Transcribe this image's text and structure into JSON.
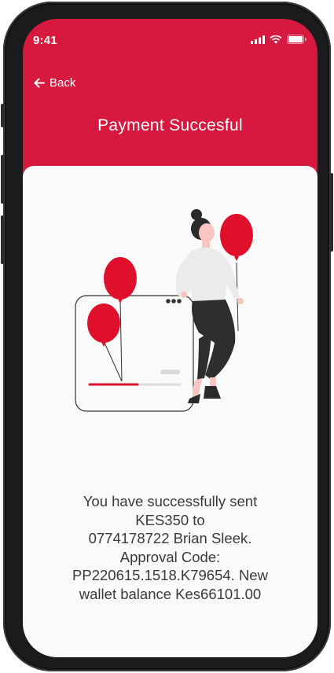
{
  "status_bar": {
    "time": "9:41",
    "icons": [
      "signal-icon",
      "wifi-icon",
      "battery-icon"
    ]
  },
  "header": {
    "back_label": "Back",
    "title": "Payment Succesful",
    "background_color": "#d8193f"
  },
  "body": {
    "illustration": "woman-with-balloons-illustration",
    "message_lines": [
      "You have successfully sent",
      "KES350 to",
      "0774178722 Brian Sleek.",
      "Approval Code:",
      "PP220615.1518.K79654. New",
      "wallet balance Kes66101.00"
    ]
  }
}
